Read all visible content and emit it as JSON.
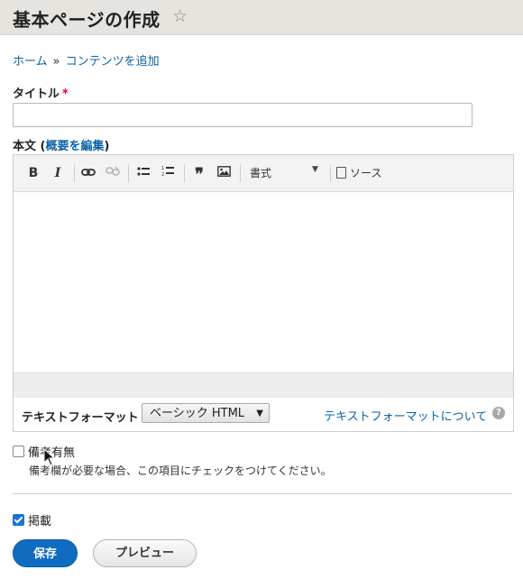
{
  "header": {
    "title": "基本ページの作成",
    "star_icon": "star-outline-icon"
  },
  "breadcrumb": {
    "items": [
      "ホーム",
      "コンテンツを追加"
    ],
    "separator": "»"
  },
  "form": {
    "title_label": "タイトル",
    "required_mark": "*",
    "title_value": "",
    "body_label": "本文 (",
    "body_summary_link": "概要を編集",
    "body_label_close": ")"
  },
  "editor": {
    "toolbar": {
      "bold": "B",
      "italic": "I",
      "format_value": "書式",
      "source_label": "ソース"
    },
    "icons": [
      "bold-icon",
      "italic-icon",
      "link-icon",
      "unlink-icon",
      "bulleted-list-icon",
      "numbered-list-icon",
      "blockquote-icon",
      "image-icon",
      "source-icon"
    ],
    "text_format_label": "テキストフォーマット",
    "text_format_value": "ベーシック HTML",
    "text_format_help_link": "テキストフォーマットについて",
    "help_icon_text": "?"
  },
  "remarks": {
    "label": "備考有無",
    "checked": false,
    "description": "備考欄が必要な場合、この項目にチェックをつけてください。"
  },
  "publish": {
    "label": "掲載",
    "checked": true
  },
  "actions": {
    "save": "保存",
    "preview": "プレビュー"
  },
  "colors": {
    "link": "#0b63a8",
    "primary_button": "#0f6cbf",
    "required": "#c8102e",
    "header_bg": "#e6e4de"
  }
}
